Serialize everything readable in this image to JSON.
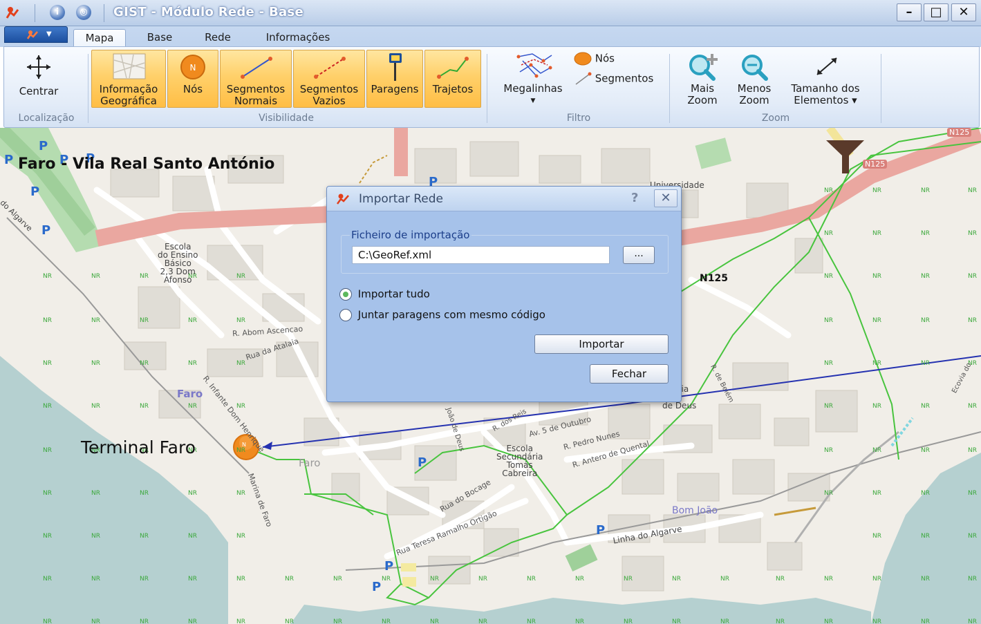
{
  "window": {
    "title": "GIST - Módulo Rede - Base",
    "controls": {
      "minimize": "–",
      "maximize": "□",
      "close": "✕"
    }
  },
  "tabs": [
    {
      "label": "Mapa",
      "active": true
    },
    {
      "label": "Base",
      "active": false
    },
    {
      "label": "Rede",
      "active": false
    },
    {
      "label": "Informações",
      "active": false
    }
  ],
  "ribbon": {
    "localizacao": {
      "label": "Localização",
      "buttons": [
        {
          "label": "Centrar",
          "icon": "crosshair-icon"
        }
      ]
    },
    "visibilidade": {
      "label": "Visibilidade",
      "buttons": [
        {
          "line1": "Informação",
          "line2": "Geográfica",
          "icon": "map-thumbnail-icon"
        },
        {
          "line1": "Nós",
          "line2": "",
          "icon": "node-icon"
        },
        {
          "line1": "Segmentos",
          "line2": "Normais",
          "icon": "segment-normal-icon"
        },
        {
          "line1": "Segmentos",
          "line2": "Vazios",
          "icon": "segment-empty-icon"
        },
        {
          "line1": "Paragens",
          "line2": "",
          "icon": "bus-stop-icon"
        },
        {
          "line1": "Trajetos",
          "line2": "",
          "icon": "route-icon"
        }
      ]
    },
    "filtro": {
      "label": "Filtro",
      "megalinhas": "Megalinhas",
      "nos": "Nós",
      "segmentos": "Segmentos"
    },
    "zoom": {
      "label": "Zoom",
      "mais": {
        "line1": "Mais",
        "line2": "Zoom"
      },
      "menos": {
        "line1": "Menos",
        "line2": "Zoom"
      },
      "tamanho": {
        "line1": "Tamanho dos",
        "line2": "Elementos ▾"
      }
    }
  },
  "map": {
    "overlay_title": "Faro - Vila Real Santo António",
    "terminal": "Terminal Faro",
    "node_letter": "N",
    "labels": {
      "faro": "Faro",
      "faro2": "Faro",
      "n125": "N125",
      "n125_badge": "N125",
      "n125_top": "N125",
      "universidade": "Universidade",
      "escola_ensino": "Escola\ndo Ensino\nBásico\n2,3 Dom\nAfonso",
      "r_abom": "R. Abom Ascencao",
      "rua_atalaia": "Rua da Atalaia",
      "r_infante": "R. Infante Dom Henrique",
      "av_5out": "Av. 5 de Outubro",
      "r_pedro": "R. Pedro Nunes",
      "r_antero": "R. Antero de Quental",
      "escola_sec": "Escola\nSecundária\nTomás\nCabreira",
      "rua_bocage": "Rua do Bocage",
      "rua_teresa": "Rua Teresa Ramalho Ortigão",
      "marina": "Marina de Faro",
      "bom_joao": "Bom João",
      "linha_algarve": "Linha do Algarve",
      "linha_algarve_left": "do Algarve",
      "escola_deus": "cola\nndária\njão\nde Deus",
      "r_belem": "R. de Belém",
      "ecovia": "Ecovia do",
      "dos_reis": "R. dos Reis",
      "rua_deus": "João de Deus",
      "parking": "P",
      "nr": "NR"
    }
  },
  "dialog": {
    "title": "Importar Rede",
    "help": "?",
    "close": "✕",
    "group_label": "Ficheiro de importação",
    "file_value": "C:\\GeoRef.xml",
    "browse": "...",
    "option_all": "Importar tudo",
    "option_join": "Juntar paragens com mesmo código",
    "selected": "option_all",
    "import_button": "Importar",
    "close_button": "Fechar"
  }
}
